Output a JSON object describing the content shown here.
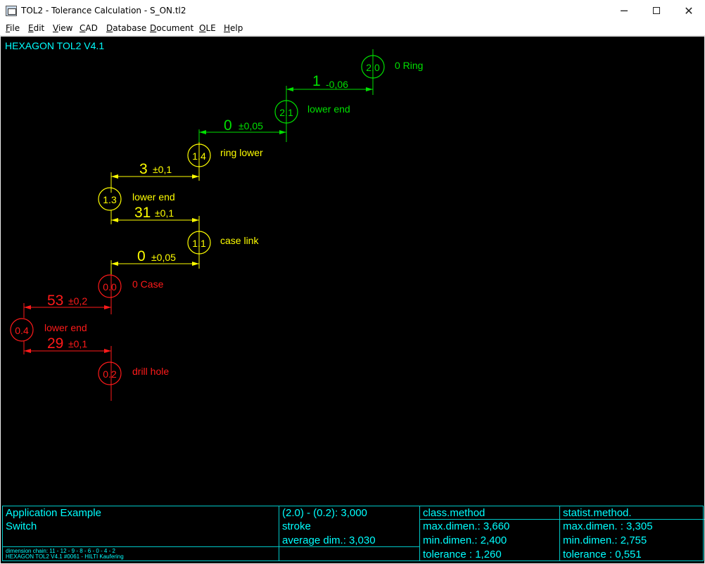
{
  "window": {
    "title": "TOL2 - Tolerance Calculation  -  S_ON.tl2",
    "minimize": "─",
    "close": "✕"
  },
  "menu": [
    {
      "u": "F",
      "rest": "ile"
    },
    {
      "u": "E",
      "rest": "dit"
    },
    {
      "u": "V",
      "rest": "iew"
    },
    {
      "u": "C",
      "rest": "AD"
    },
    {
      "u": "D",
      "rest": "atabase"
    },
    {
      "u": "D",
      "rest": "ocument"
    },
    {
      "u": "O",
      "rest": "LE"
    },
    {
      "u": "H",
      "rest": "elp"
    }
  ],
  "canvas": {
    "brand": "HEXAGON TOL2 V4.1"
  },
  "colors": {
    "green": "#00e000",
    "yellow": "#ffff00",
    "red": "#ff1a1a",
    "cyan": "#00ffff"
  },
  "nodes": [
    {
      "id": "2.0",
      "label": "0 Ring",
      "color": "green"
    },
    {
      "id": "2.1",
      "label": "lower end",
      "color": "green"
    },
    {
      "id": "1.4",
      "label": "ring lower",
      "color": "yellow"
    },
    {
      "id": "1.3",
      "label": "lower end",
      "color": "yellow"
    },
    {
      "id": "1.1",
      "label": "case link",
      "color": "yellow"
    },
    {
      "id": "0.0",
      "label": "0 Case",
      "color": "red"
    },
    {
      "id": "0.4",
      "label": "lower end",
      "color": "red"
    },
    {
      "id": "0.2",
      "label": "drill hole",
      "color": "red"
    }
  ],
  "dimensions": [
    {
      "value": "1",
      "tol": "-0,06",
      "color": "green"
    },
    {
      "value": "0",
      "tol": "±0,05",
      "color": "green"
    },
    {
      "value": "3",
      "tol": "±0,1",
      "color": "yellow"
    },
    {
      "value": "31",
      "tol": "±0,1",
      "color": "yellow"
    },
    {
      "value": "0",
      "tol": "±0,05",
      "color": "yellow"
    },
    {
      "value": "53",
      "tol": "±0,2",
      "color": "red"
    },
    {
      "value": "29",
      "tol": "±0,1",
      "color": "red"
    }
  ],
  "info": {
    "app_title": "Application Example",
    "app_name": "Switch",
    "chain_line": "dimension chain: 11 - 12 - 9 - 8 - 6 - 0 - 4 - 2",
    "footer_line": "HEXAGON TOL2 V4.1 #0061 - HILTI Kaufering",
    "range": "(2.0) - (0.2): 3,000",
    "stroke": "stroke",
    "average": "average dim.: 3,030",
    "class": {
      "title": "class.method",
      "max": "max.dimen.: 3,660",
      "min": "min.dimen.: 2,400",
      "tol": "tolerance : 1,260"
    },
    "statist": {
      "title": "statist.method.",
      "max": "max.dimen. : 3,305",
      "min": "min.dimen.: 2,755",
      "tol": "tolerance : 0,551"
    }
  }
}
